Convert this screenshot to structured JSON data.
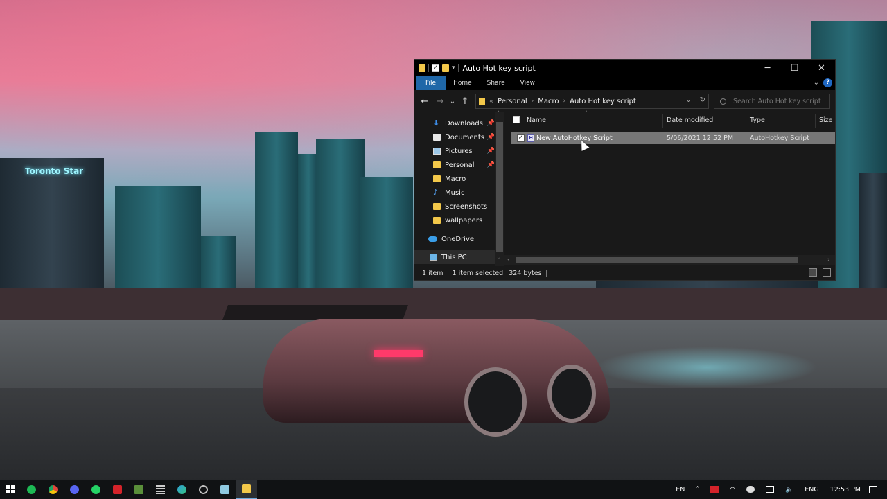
{
  "window": {
    "title": "Auto Hot key script",
    "controls": {
      "minimize": "─",
      "maximize": "☐",
      "close": "✕"
    }
  },
  "ribbon": {
    "tabs": [
      "File",
      "Home",
      "Share",
      "View"
    ],
    "active_tab": "File",
    "help": "?"
  },
  "navigation": {
    "back": "←",
    "forward": "→",
    "recent": "⌄",
    "up": "↑",
    "breadcrumb": [
      "Personal",
      "Macro",
      "Auto Hot key script"
    ],
    "breadcrumb_overflow": "«",
    "search_placeholder": "Search Auto Hot key script"
  },
  "nav_pane": {
    "items": [
      {
        "label": "Downloads",
        "icon": "download-icon",
        "pinned": true
      },
      {
        "label": "Documents",
        "icon": "document-icon",
        "pinned": true
      },
      {
        "label": "Pictures",
        "icon": "picture-icon",
        "pinned": true
      },
      {
        "label": "Personal",
        "icon": "folder-icon",
        "pinned": true
      },
      {
        "label": "Macro",
        "icon": "folder-icon",
        "pinned": false
      },
      {
        "label": "Music",
        "icon": "music-icon",
        "pinned": false
      },
      {
        "label": "Screenshots",
        "icon": "folder-icon",
        "pinned": false
      },
      {
        "label": "wallpapers",
        "icon": "folder-icon",
        "pinned": false
      },
      {
        "label": "OneDrive",
        "icon": "cloud-icon",
        "pinned": false
      },
      {
        "label": "This PC",
        "icon": "computer-icon",
        "pinned": false,
        "selected": true
      }
    ]
  },
  "file_list": {
    "columns": [
      "Name",
      "Date modified",
      "Type",
      "Size"
    ],
    "rows": [
      {
        "name": "New AutoHotkey Script",
        "date_modified": "5/06/2021 12:52 PM",
        "type": "AutoHotkey Script",
        "selected": true,
        "checked": true
      }
    ]
  },
  "status": {
    "count": "1 item",
    "selection": "1 item selected",
    "size": "324 bytes"
  },
  "desktop": {
    "sign_text": "Toronto Star"
  },
  "taskbar": {
    "apps": [
      {
        "name": "spotify",
        "color": "#1db954"
      },
      {
        "name": "chrome",
        "color": "#e0463a"
      },
      {
        "name": "discord",
        "color": "#5865f2"
      },
      {
        "name": "whatsapp",
        "color": "#25d366"
      },
      {
        "name": "red-app",
        "color": "#d4232a"
      },
      {
        "name": "minecraft",
        "color": "#5a8f3a"
      },
      {
        "name": "settings-sliders",
        "color": "#cccccc"
      },
      {
        "name": "edge",
        "color": "#2e9fd6"
      },
      {
        "name": "circle-app",
        "color": "#bfbfbf"
      },
      {
        "name": "notepad",
        "color": "#8fc9e0"
      },
      {
        "name": "file-explorer",
        "color": "#f3c84a",
        "active": true
      }
    ],
    "tray": {
      "language": "EN",
      "keyboard": "ENG",
      "time": "12:53 PM"
    }
  },
  "colors": {
    "accent": "#1f67a8",
    "selection": "#777777",
    "window_bg": "#191919"
  }
}
